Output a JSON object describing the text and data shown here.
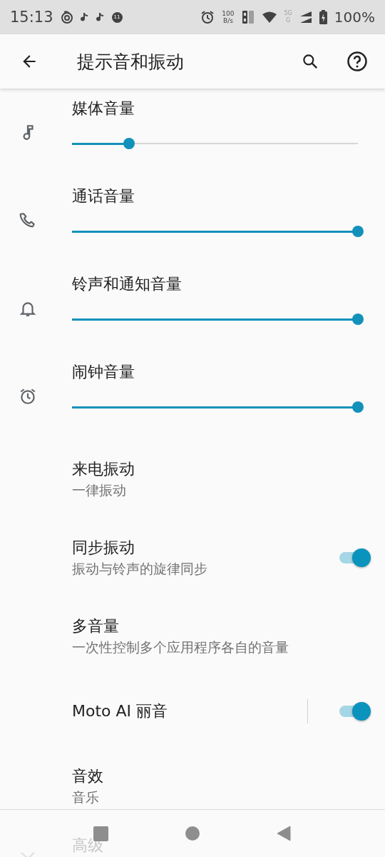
{
  "status_bar": {
    "time": "15:13",
    "notification_count": "11",
    "net_speed": "100",
    "net_unit": "B/s",
    "network_type_top": "5G",
    "network_type_bottom": "G",
    "battery": "100%"
  },
  "app_bar": {
    "title": "提示音和振动"
  },
  "volume_sliders": [
    {
      "kind": "music",
      "label": "媒体音量",
      "level": 0.2
    },
    {
      "kind": "phone",
      "label": "通话音量",
      "level": 1
    },
    {
      "kind": "bell",
      "label": "铃声和通知音量",
      "level": 1
    },
    {
      "kind": "alarm",
      "label": "闹钟音量",
      "level": 1
    }
  ],
  "settings": [
    {
      "kind": "text",
      "title": "来电振动",
      "summary": "一律振动"
    },
    {
      "kind": "switch",
      "title": "同步振动",
      "summary": "振动与铃声的旋律同步",
      "on": true
    },
    {
      "kind": "text",
      "title": "多音量",
      "summary": "一次性控制多个应用程序各自的音量"
    },
    {
      "kind": "split-switch",
      "title": "Moto AI 丽音",
      "on": true
    },
    {
      "kind": "text",
      "title": "音效",
      "summary": "音乐"
    }
  ],
  "advanced": {
    "title": "高级"
  }
}
